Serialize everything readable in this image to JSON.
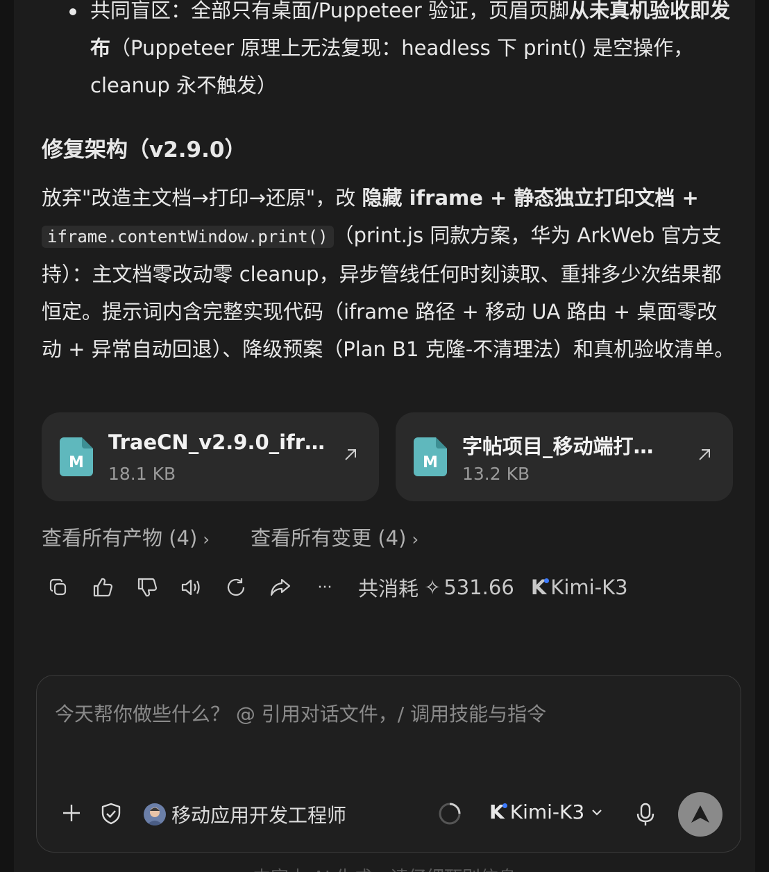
{
  "message": {
    "bullet": {
      "prefix": "共同盲区：全部只有桌面/Puppeteer 验证，页眉页脚",
      "bold": "从未真机验收即发布",
      "suffix": "（Puppeteer 原理上无法复现：headless 下 print() 是空操作，cleanup 永不触发）"
    },
    "heading": "修复架构（v2.9.0）",
    "paragraph": {
      "part1": "放弃\"改造主文档→打印→还原\"，改 ",
      "bold": "隐藏 iframe + 静态独立打印文档 + ",
      "code": "iframe.contentWindow.print()",
      "part2": "（print.js 同款方案，华为 ArkWeb 官方支持）：主文档零改动零 cleanup，异步管线任何时刻读取、重排多少次结果都恒定。提示词内含完整实现代码（iframe 路径 + 移动 UA 路由 + 桌面零改动 + 异常自动回退）、降级预案（Plan B1 克隆-不清理法）和真机验收清单。"
    }
  },
  "files": [
    {
      "title": "TraeCN_v2.9.0_ifr…",
      "size": "18.1 KB",
      "icon": "markdown-file-icon"
    },
    {
      "title": "字帖项目_移动端打…",
      "size": "13.2 KB",
      "icon": "markdown-file-icon"
    }
  ],
  "links": {
    "artifacts": "查看所有产物 (4)",
    "changes": "查看所有变更 (4)",
    "chevron": "›"
  },
  "actions": {
    "icons": [
      "copy-icon",
      "thumbs-up-icon",
      "thumbs-down-icon",
      "speaker-icon",
      "refresh-icon",
      "share-icon",
      "more-icon"
    ],
    "more_label": "···",
    "cost_label": "共消耗",
    "cost_symbol": "✧",
    "cost_value": "531.66",
    "model_logo": "K",
    "model_name": "Kimi-K3"
  },
  "composer": {
    "placeholder": "今天帮你做些什么？ @ 引用对话文件，/ 调用技能与指令",
    "agent_name": "移动应用开发工程师",
    "model_logo": "K",
    "model_name": "Kimi-K3",
    "accent_color": "#3d7bff"
  },
  "footnote": "内容由 AI 生成，请仔细甄别信息"
}
